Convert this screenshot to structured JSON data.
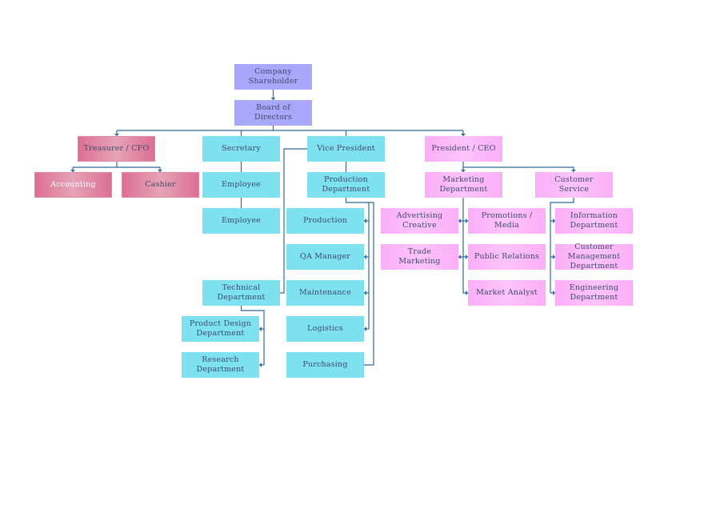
{
  "colors": {
    "connector": "#2f6b9b",
    "executive": "#a8a8fb",
    "operations": "#7ee1ef",
    "finance": "#dc6f94",
    "marketing": "#fbaef7",
    "text": "#3d4a6b"
  },
  "nodes": {
    "shareholder": {
      "label": "Company\nShareholder",
      "style": "purple"
    },
    "board": {
      "label": "Board of\nDirectors",
      "style": "purple"
    },
    "treasurer": {
      "label": "Treasurer / CFO",
      "style": "rose"
    },
    "accounting": {
      "label": "Accounting",
      "style": "rose white-text"
    },
    "cashier": {
      "label": "Cashier",
      "style": "rose"
    },
    "secretary": {
      "label": "Secretary",
      "style": "cyan"
    },
    "employee1": {
      "label": "Employee",
      "style": "cyan"
    },
    "employee2": {
      "label": "Employee",
      "style": "cyan"
    },
    "vp": {
      "label": "Vice President",
      "style": "cyan"
    },
    "proddept": {
      "label": "Production\nDepartment",
      "style": "cyan"
    },
    "production": {
      "label": "Production",
      "style": "cyan"
    },
    "qa": {
      "label": "QA Manager",
      "style": "cyan"
    },
    "maintenance": {
      "label": "Maintenance",
      "style": "cyan"
    },
    "logistics": {
      "label": "Logistics",
      "style": "cyan"
    },
    "purchasing": {
      "label": "Purchasing",
      "style": "cyan"
    },
    "technical": {
      "label": "Technical\nDepartment",
      "style": "cyan"
    },
    "productdesign": {
      "label": "Product Design\nDepartment",
      "style": "cyan"
    },
    "research": {
      "label": "Research\nDepartment",
      "style": "cyan"
    },
    "president": {
      "label": "President / CEO",
      "style": "pink"
    },
    "marketing": {
      "label": "Marketing\nDepartment",
      "style": "pink"
    },
    "customerservice": {
      "label": "Customer\nService",
      "style": "pink"
    },
    "advertising": {
      "label": "Advertising\nCreative",
      "style": "pink"
    },
    "promotions": {
      "label": "Promotions /\nMedia",
      "style": "pink"
    },
    "trade": {
      "label": "Trade\nMarketing",
      "style": "pink"
    },
    "pr": {
      "label": "Public Relations",
      "style": "pink"
    },
    "analyst": {
      "label": "Market Analyst",
      "style": "pink"
    },
    "information": {
      "label": "Information\nDepartment",
      "style": "pink"
    },
    "custmgmt": {
      "label": "Customer\nManagement\nDepartment",
      "style": "pink"
    },
    "engineering": {
      "label": "Engineering\nDepartment",
      "style": "pink"
    }
  }
}
